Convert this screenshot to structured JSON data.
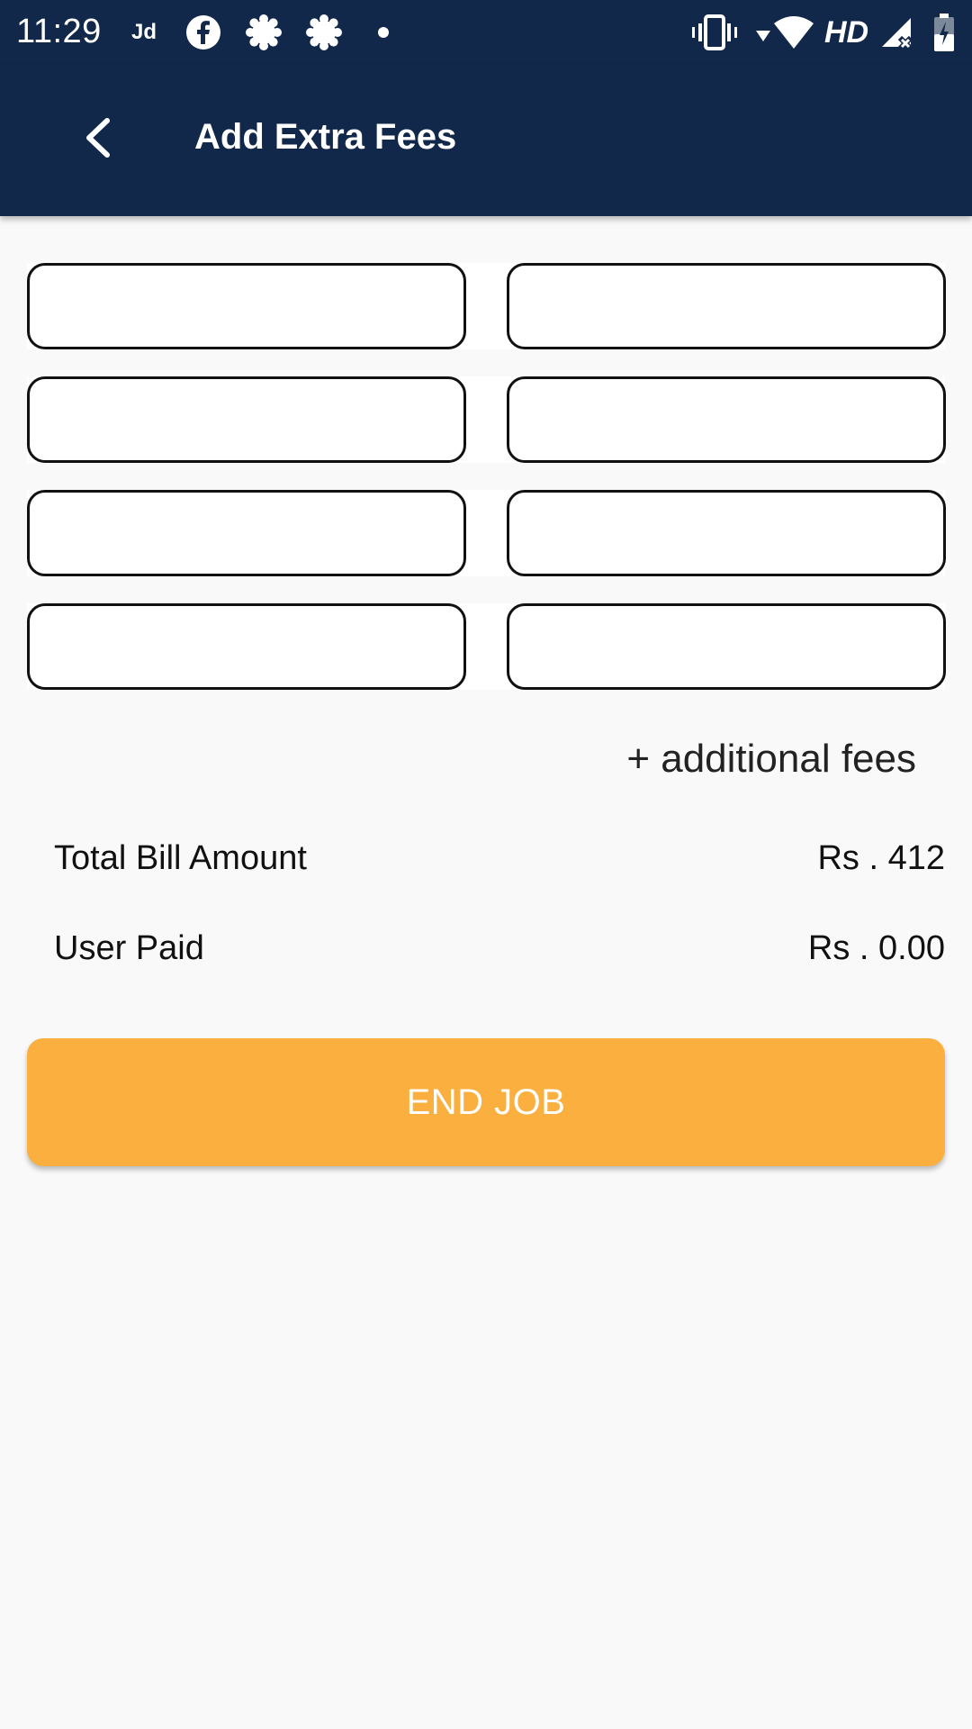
{
  "status_bar": {
    "time": "11:29",
    "left_icons": [
      "jd-icon",
      "facebook-icon",
      "settings-gear-icon",
      "settings-gear-icon",
      "dot-icon"
    ],
    "jd_label": "Jd",
    "network_label": "HD",
    "right_icons": [
      "vibrate-icon",
      "wifi-icon",
      "signal-icon",
      "battery-charging-icon"
    ]
  },
  "app_bar": {
    "title": "Add Extra Fees",
    "back_icon": "chevron-left-icon"
  },
  "fees": {
    "rows": [
      {
        "name": "",
        "amount": ""
      },
      {
        "name": "",
        "amount": ""
      },
      {
        "name": "",
        "amount": ""
      },
      {
        "name": "",
        "amount": ""
      }
    ],
    "add_label": "+ additional fees"
  },
  "summary": {
    "total_label": "Total Bill Amount",
    "total_value": "Rs . 412",
    "paid_label": "User Paid",
    "paid_value": "Rs . 0.00"
  },
  "actions": {
    "end_job_label": "END JOB"
  },
  "colors": {
    "header": "#12284a",
    "accent": "#faaf3f",
    "background": "#f9f9f9"
  }
}
